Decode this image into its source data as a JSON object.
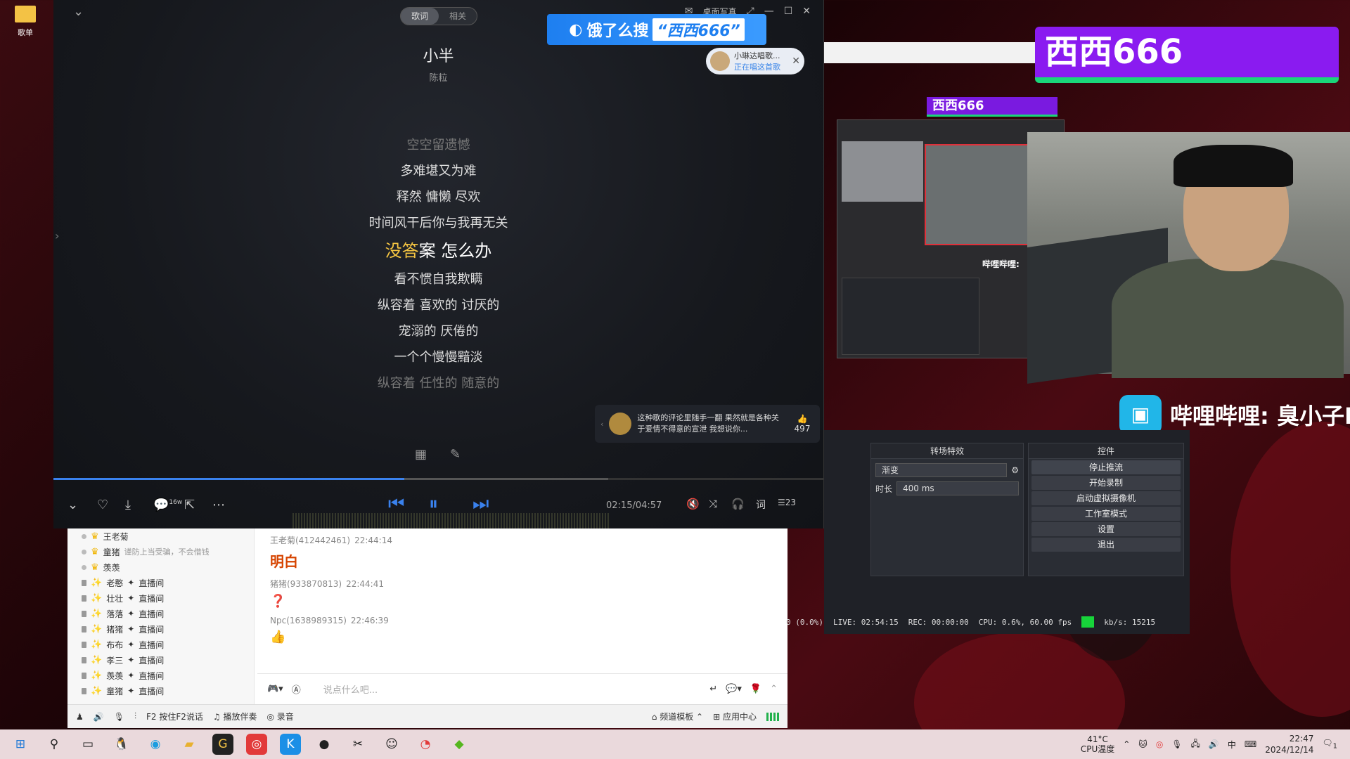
{
  "desktop": {
    "folder_label": "歌单"
  },
  "player": {
    "tabs": [
      {
        "label": "歌词",
        "active": true
      },
      {
        "label": "相关",
        "active": false
      }
    ],
    "desktop_lyrics": "桌面写真",
    "song_title": "小半",
    "song_artist": "陈粒",
    "ad": {
      "prefix": "饿了么搜",
      "highlight": "“西西666”"
    },
    "listening": {
      "name": "小琳达唱歌...",
      "status": "正在唱这首歌"
    },
    "lyrics": [
      {
        "text": "空空留遗憾",
        "state": "dim"
      },
      {
        "text": "多难堪又为难",
        "state": "normal"
      },
      {
        "text": "释然 慵懒 尽欢",
        "state": "normal"
      },
      {
        "text": "时间风干后你与我再无关",
        "state": "normal"
      },
      {
        "done": "没答",
        "rest": "案 怎么办",
        "state": "current"
      },
      {
        "text": "看不惯自我欺瞒",
        "state": "normal"
      },
      {
        "text": "纵容着 喜欢的 讨厌的",
        "state": "normal"
      },
      {
        "text": "宠溺的 厌倦的",
        "state": "normal"
      },
      {
        "text": "一个个慢慢黯淡",
        "state": "normal"
      },
      {
        "text": "纵容着 任性的 随意的",
        "state": "dim"
      }
    ],
    "hot_comment": {
      "text": "这种歌的评论里随手一翻 果然就是各种关于爱情不得意的宣泄 我想说你...",
      "likes": "497"
    },
    "comment_count": "16w",
    "playback": {
      "elapsed": "02:15",
      "total": "04:57",
      "progress": 0.455,
      "buffered": 0.72
    },
    "queue_count": "23",
    "lyric_btn": "词"
  },
  "chat": {
    "users": [
      {
        "name": "王老菊",
        "type": "member"
      },
      {
        "name": "童猪",
        "type": "member",
        "note": "谨防上当受骗，不会借钱"
      },
      {
        "name": "羡羡",
        "type": "member"
      },
      {
        "name": "老憨",
        "type": "room",
        "suffix": "直播间"
      },
      {
        "name": "壮壮",
        "type": "room",
        "suffix": "直播间"
      },
      {
        "name": "落落",
        "type": "room",
        "suffix": "直播间"
      },
      {
        "name": "猪猪",
        "type": "room",
        "suffix": "直播间"
      },
      {
        "name": "布布",
        "type": "room",
        "suffix": "直播间"
      },
      {
        "name": "孝三",
        "type": "room",
        "suffix": "直播间"
      },
      {
        "name": "羡羡",
        "type": "room",
        "suffix": "直播间"
      },
      {
        "name": "童猪",
        "type": "room",
        "suffix": "直播间"
      }
    ],
    "messages": [
      {
        "author": "王老菊(412442461)",
        "time": "22:44:14",
        "body": "明白",
        "kind": "text"
      },
      {
        "author": "猪猪(933870813)",
        "time": "22:44:41",
        "body": "❓",
        "kind": "q"
      },
      {
        "author": "Npc(1638989315)",
        "time": "22:46:39",
        "body": "👍",
        "kind": "th"
      }
    ],
    "input_placeholder": "说点什么吧...",
    "bottom": {
      "f2_talk": "按住F2说话",
      "accompany": "播放伴奏",
      "record": "录音",
      "channel_template": "频道模板",
      "app_center": "应用中心"
    }
  },
  "obs": {
    "transition_header": "转场特效",
    "transition_value": "渐变",
    "duration_label": "时长",
    "duration_value": "400 ms",
    "controls_header": "控件",
    "controls": [
      "停止推流",
      "开始录制",
      "启动虚拟摄像机",
      "工作室模式",
      "设置",
      "退出"
    ],
    "status": {
      "dropped": "0 (0.0%)",
      "live": "LIVE: 02:54:15",
      "rec": "REC: 00:00:00",
      "cpu": "CPU: 0.6%, 60.00 fps",
      "kbps": "kb/s: 15215"
    }
  },
  "stream": {
    "nick_large": "西西666",
    "nick_small": "西西666",
    "bili_text": "哔哩哔哩: 臭小子N",
    "bili_small": "哔哩哔哩:"
  },
  "taskbar": {
    "temp": "41°C",
    "temp_label": "CPU温度",
    "ime": "中",
    "time": "22:47",
    "date": "2024/12/14",
    "notifications": "1"
  }
}
